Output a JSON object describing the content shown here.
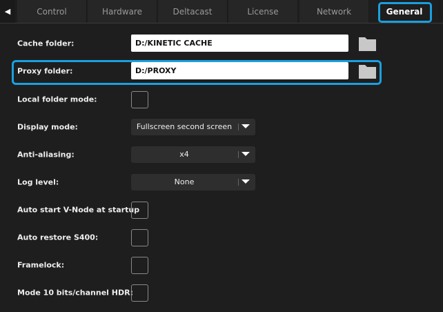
{
  "tabs": [
    "Control",
    "Hardware",
    "Deltacast",
    "License",
    "Network",
    "General"
  ],
  "active_tab": "General",
  "cache_folder": {
    "label": "Cache folder:",
    "value": "D:/KINETIC CACHE"
  },
  "proxy_folder": {
    "label": "Proxy folder:",
    "value": "D:/PROXY"
  },
  "local_folder_mode": {
    "label": "Local folder mode:",
    "checked": false
  },
  "display_mode": {
    "label": "Display mode:",
    "value": "Fullscreen second screen"
  },
  "anti_aliasing": {
    "label": "Anti-aliasing:",
    "value": "x4"
  },
  "log_level": {
    "label": "Log level:",
    "value": "None"
  },
  "auto_start": {
    "label": "Auto start V-Node at startup",
    "checked": false
  },
  "auto_restore": {
    "label": "Auto restore S400:",
    "checked": false
  },
  "framelock": {
    "label": "Framelock:",
    "checked": false
  },
  "mode10": {
    "label": "Mode 10 bits/channel HDR:",
    "checked": false
  },
  "accent": "#1aa0e0"
}
